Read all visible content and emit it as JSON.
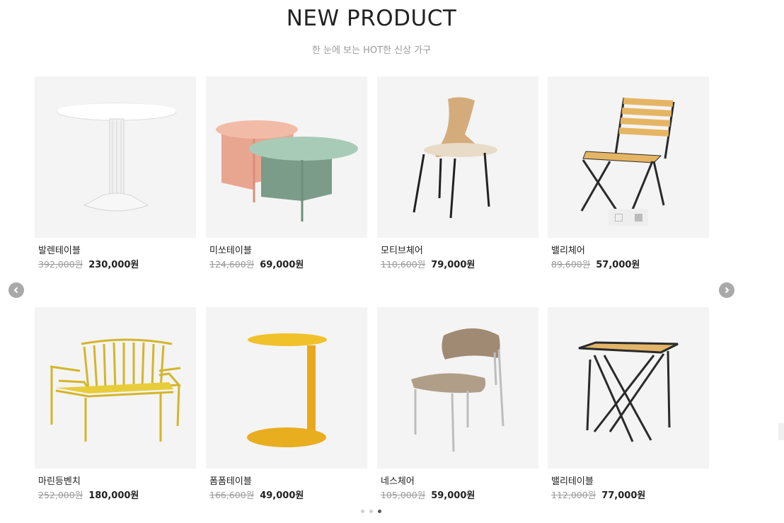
{
  "header": {
    "title": "NEW PRODUCT",
    "subtitle": "한 눈에 보는 HOT한 신상 가구"
  },
  "products": [
    {
      "name": "발렌테이블",
      "old_price": "392,000원",
      "price": "230,000원",
      "image": "white-pedestal-table"
    },
    {
      "name": "미쏘테이블",
      "old_price": "124,600원",
      "price": "69,000원",
      "image": "pink-green-round-tables"
    },
    {
      "name": "모티브체어",
      "old_price": "110,600원",
      "price": "79,000원",
      "image": "wood-shell-chair"
    },
    {
      "name": "밸리체어",
      "old_price": "89,600원",
      "price": "57,000원",
      "image": "folding-slat-chair"
    },
    {
      "name": "마린등벤치",
      "old_price": "252,000원",
      "price": "180,000원",
      "image": "yellow-bench"
    },
    {
      "name": "폼폼테이블",
      "old_price": "166,600원",
      "price": "49,000원",
      "image": "yellow-side-table"
    },
    {
      "name": "네스체어",
      "old_price": "105,000원",
      "price": "59,000원",
      "image": "beige-upholstered-chair"
    },
    {
      "name": "밸리테이블",
      "old_price": "112,000원",
      "price": "77,000원",
      "image": "folding-square-table"
    }
  ],
  "carousel": {
    "prev_icon": "chevron-left-icon",
    "next_icon": "chevron-right-icon",
    "page_count": 3,
    "active_page": 3
  },
  "colors": {
    "thumb_bg": "#f4f4f4",
    "arrow_bg": "#a9a9a9",
    "old_price": "#999999"
  }
}
